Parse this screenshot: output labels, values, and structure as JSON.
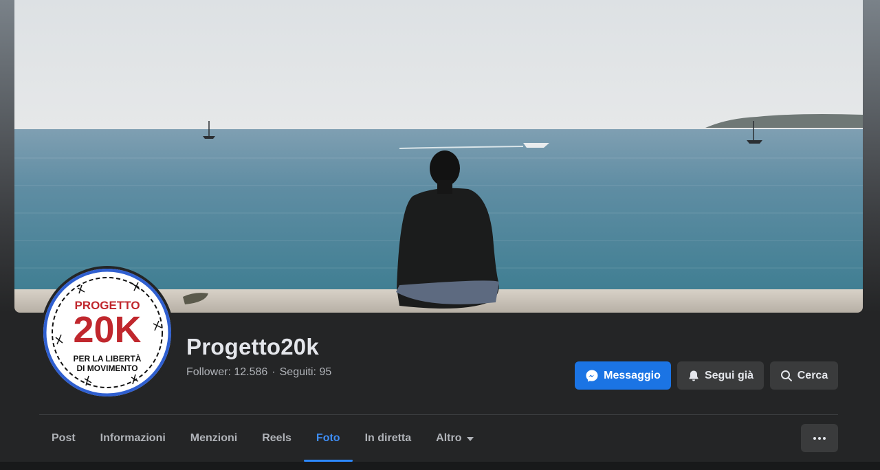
{
  "page": {
    "name": "Progetto20k",
    "followers_label": "Follower: 12.586",
    "following_label": "Seguiti: 95",
    "separator": "·"
  },
  "avatar": {
    "logo_text_top": "PROGETTO",
    "logo_text_big": "20K",
    "logo_text_line1": "PER LA LIBERTÀ",
    "logo_text_line2": "DI MOVIMENTO"
  },
  "actions": {
    "message_label": "Messaggio",
    "message_icon": "messenger-icon",
    "follow_label": "Segui già",
    "follow_icon": "bell-icon",
    "search_label": "Cerca",
    "search_icon": "search-icon",
    "more_icon": "more-dots-icon"
  },
  "tabs": [
    {
      "label": "Post",
      "active": false
    },
    {
      "label": "Informazioni",
      "active": false
    },
    {
      "label": "Menzioni",
      "active": false
    },
    {
      "label": "Reels",
      "active": false
    },
    {
      "label": "Foto",
      "active": true
    },
    {
      "label": "In diretta",
      "active": false
    },
    {
      "label": "Altro",
      "active": false,
      "has_dropdown": true
    }
  ],
  "colors": {
    "background": "#242526",
    "accent": "#1b74e4",
    "active_tab": "#3e8ef7",
    "secondary_button": "#3a3b3c",
    "logo_red": "#c0272d",
    "logo_blue": "#2f5fd0"
  }
}
